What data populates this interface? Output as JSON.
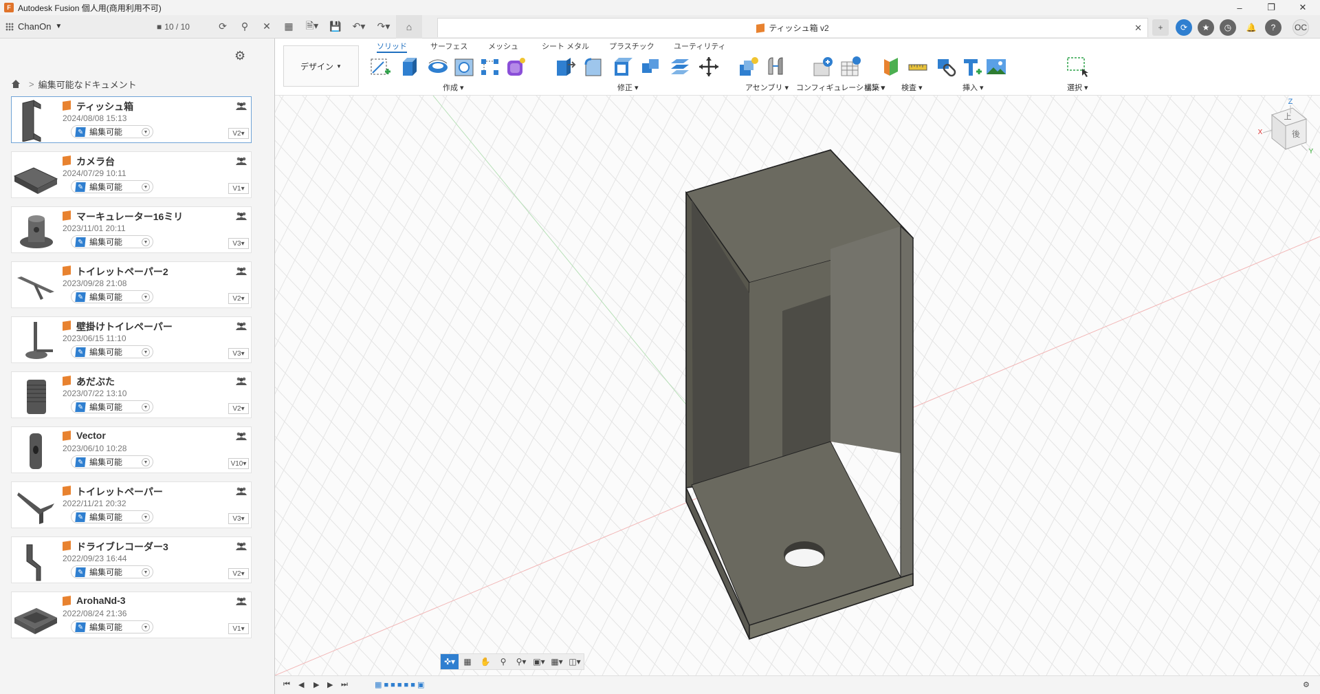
{
  "window": {
    "title": "Autodesk Fusion 個人用(商用利用不可)"
  },
  "appbar": {
    "user": "ChanOn",
    "counter": "10 / 10"
  },
  "doc_tab": {
    "title": "ティッシュ箱 v2"
  },
  "user_initials": "OC",
  "sidebar": {
    "breadcrumb": "編集可能なドキュメント",
    "documents": [
      {
        "name": "ティッシュ箱",
        "date": "2024/08/08 15:13",
        "permission": "編集可能",
        "version": "V2"
      },
      {
        "name": "カメラ台",
        "date": "2024/07/29 10:11",
        "permission": "編集可能",
        "version": "V1"
      },
      {
        "name": "マーキュレーター16ミリ",
        "date": "2023/11/01 20:11",
        "permission": "編集可能",
        "version": "V3"
      },
      {
        "name": "トイレットペーパー2",
        "date": "2023/09/28 21:08",
        "permission": "編集可能",
        "version": "V2"
      },
      {
        "name": "壁掛けトイレペーパー",
        "date": "2023/06/15 11:10",
        "permission": "編集可能",
        "version": "V3"
      },
      {
        "name": "あだぶた",
        "date": "2023/07/22 13:10",
        "permission": "編集可能",
        "version": "V2"
      },
      {
        "name": "Vector",
        "date": "2023/06/10 10:28",
        "permission": "編集可能",
        "version": "V10"
      },
      {
        "name": "トイレットペーパー",
        "date": "2022/11/21 20:32",
        "permission": "編集可能",
        "version": "V3"
      },
      {
        "name": "ドライブレコーダー3",
        "date": "2022/09/23 16:44",
        "permission": "編集可能",
        "version": "V2"
      },
      {
        "name": "ArohaNd-3",
        "date": "2022/08/24 21:36",
        "permission": "編集可能",
        "version": "V1"
      }
    ]
  },
  "toolbar": {
    "workspace": "デザイン",
    "tabs": [
      "ソリッド",
      "サーフェス",
      "メッシュ",
      "シート メタル",
      "プラスチック",
      "ユーティリティ"
    ],
    "groups": [
      "作成",
      "修正",
      "アセンブリ",
      "コンフィギュレーション",
      "構築",
      "検査",
      "挿入",
      "選択"
    ]
  },
  "viewcube": {
    "top": "上",
    "back": "後",
    "axis_z": "Z",
    "axis_x": "X",
    "axis_y": "Y"
  },
  "colors": {
    "accent": "#1f6fbf",
    "doc_icon": "#e8822f",
    "model": "#6b6a60"
  }
}
